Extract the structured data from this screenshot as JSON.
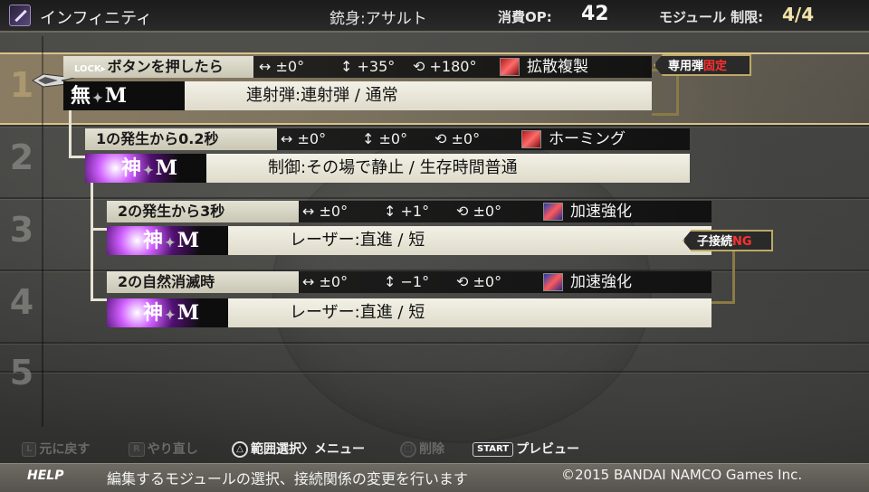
{
  "header": {
    "title": "インフィニティ",
    "barrel": "銃身:アサルト",
    "op_label": "消費OP:",
    "op_value": "42",
    "module_label": "モジュール 制限:",
    "module_value": "4/4"
  },
  "slots": [
    "1",
    "2",
    "3",
    "4",
    "5"
  ],
  "modules": [
    {
      "lock": "LOCK▸",
      "condition": "ボタンを押したら",
      "h": "↔ ±0°",
      "v": "↕ +35°",
      "r": "⟲ +180°",
      "mod_name": "拡散複製",
      "kanji": "無",
      "grade": "M",
      "bullet": "連射弾:連射弾 / 通常"
    },
    {
      "condition": "1の発生から0.2秒",
      "h": "↔ ±0°",
      "v": "↕ ±0°",
      "r": "⟲ ±0°",
      "mod_name": "ホーミング",
      "kanji": "神",
      "grade": "M",
      "bullet": "制御:その場で静止 / 生存時間普通"
    },
    {
      "condition": "2の発生から3秒",
      "h": "↔ ±0°",
      "v": "↕ +1°",
      "r": "⟲ ±0°",
      "mod_name": "加速強化",
      "kanji": "神",
      "grade": "M",
      "bullet": "レーザー:直進 / 短"
    },
    {
      "condition": "2の自然消滅時",
      "h": "↔ ±0°",
      "v": "↕ −1°",
      "r": "⟲ ±0°",
      "mod_name": "加速強化",
      "kanji": "神",
      "grade": "M",
      "bullet": "レーザー:直進 / 短"
    }
  ],
  "tags": {
    "exclusive_prefix": "専用弾",
    "exclusive_hl": "固定",
    "child_prefix": "子接続",
    "child_hl": "NG"
  },
  "controls": {
    "undo_btn": "L",
    "undo": "元に戻す",
    "redo_btn": "R",
    "redo": "やり直し",
    "range_btn": "△",
    "range": "範囲選択",
    "range_menu": "メニュー",
    "delete_btn": "□",
    "delete": "削除",
    "preview_btn": "START",
    "preview": "プレビュー"
  },
  "help": {
    "label": "HELP",
    "text": "編集するモジュールの選択、接続関係の変更を行います",
    "copyright": "©2015 BANDAI NAMCO Games Inc."
  },
  "colors": {
    "highlight_border": "#d8c28a",
    "tag_accent": "#ff3030",
    "header_value": "#f2e4a8"
  }
}
